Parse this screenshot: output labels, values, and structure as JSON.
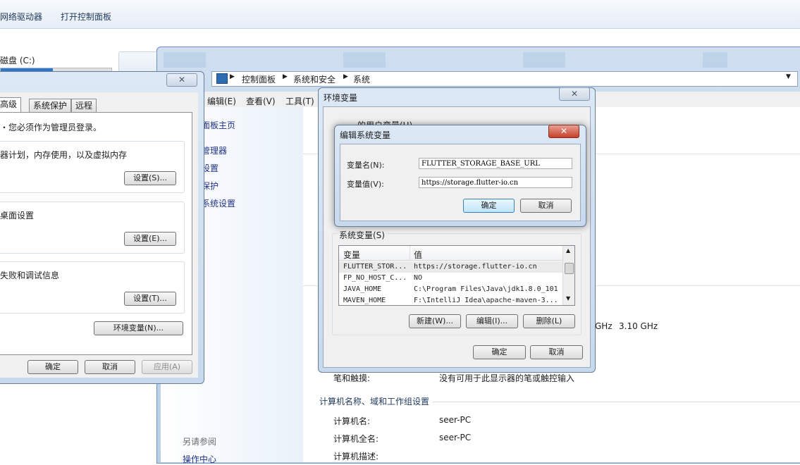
{
  "explorer": {
    "cmd_items": [
      "网络驱动器",
      "打开控制面板"
    ],
    "drive_label": "磁盘 (C:)",
    "drive_usage_fraction": 0.47
  },
  "control_panel": {
    "breadcrumb": [
      "控制面板",
      "系统和安全",
      "系统"
    ],
    "menu": [
      "编辑(E)",
      "查看(V)",
      "工具(T)"
    ],
    "left_links": [
      "面板主页",
      "管理器",
      "设置",
      "保护",
      "系统设置"
    ],
    "see_also_label": "另请参阅",
    "see_also_links": [
      "操作中心"
    ],
    "cpu_speed_partial": "GHz",
    "cpu_speed": "3.10 GHz",
    "pen_touch_label": "笔和触摸:",
    "pen_touch_value": "没有可用于此显示器的笔或触控输入",
    "computer_section_title": "计算机名称、域和工作组设置",
    "rows": [
      {
        "label": "计算机名:",
        "value": "seer-PC"
      },
      {
        "label": "计算机全名:",
        "value": "seer-PC"
      },
      {
        "label": "计算机描述:",
        "value": ""
      }
    ]
  },
  "system_props": {
    "tabs": [
      "高级",
      "系统保护",
      "远程"
    ],
    "admin_note": "您必须作为管理员登录。",
    "perf_text": "器计划，内存使用，以及虚拟内存",
    "perf_button": "设置(S)...",
    "profile_text": "桌面设置",
    "profile_button": "设置(E)...",
    "startup_text": "失败和调试信息",
    "startup_button": "设置(T)...",
    "env_button": "环境变量(N)...",
    "ok": "确定",
    "cancel": "取消",
    "apply": "应用(A)"
  },
  "env_vars": {
    "title": "环境变量",
    "user_vars_label": "的用户变量(U)",
    "system_vars_label": "系统变量(S)",
    "columns": [
      "变量",
      "值"
    ],
    "rows": [
      {
        "name": "FLUTTER_STOR...",
        "value": "https://storage.flutter-io.cn"
      },
      {
        "name": "FP_NO_HOST_C...",
        "value": "NO"
      },
      {
        "name": "JAVA_HOME",
        "value": "C:\\Program Files\\Java\\jdk1.8.0_101"
      },
      {
        "name": "MAVEN_HOME",
        "value": "F:\\IntelliJ Idea\\apache-maven-3..."
      }
    ],
    "new_button": "新建(W)...",
    "edit_button": "编辑(I)...",
    "delete_button": "删除(L)",
    "ok": "确定",
    "cancel": "取消"
  },
  "edit_var": {
    "title": "编辑系统变量",
    "name_label": "变量名(N):",
    "name_value": "FLUTTER_STORAGE_BASE_URL",
    "value_label": "变量值(V):",
    "value_value": "https://storage.flutter-io.cn",
    "ok": "确定",
    "cancel": "取消"
  }
}
